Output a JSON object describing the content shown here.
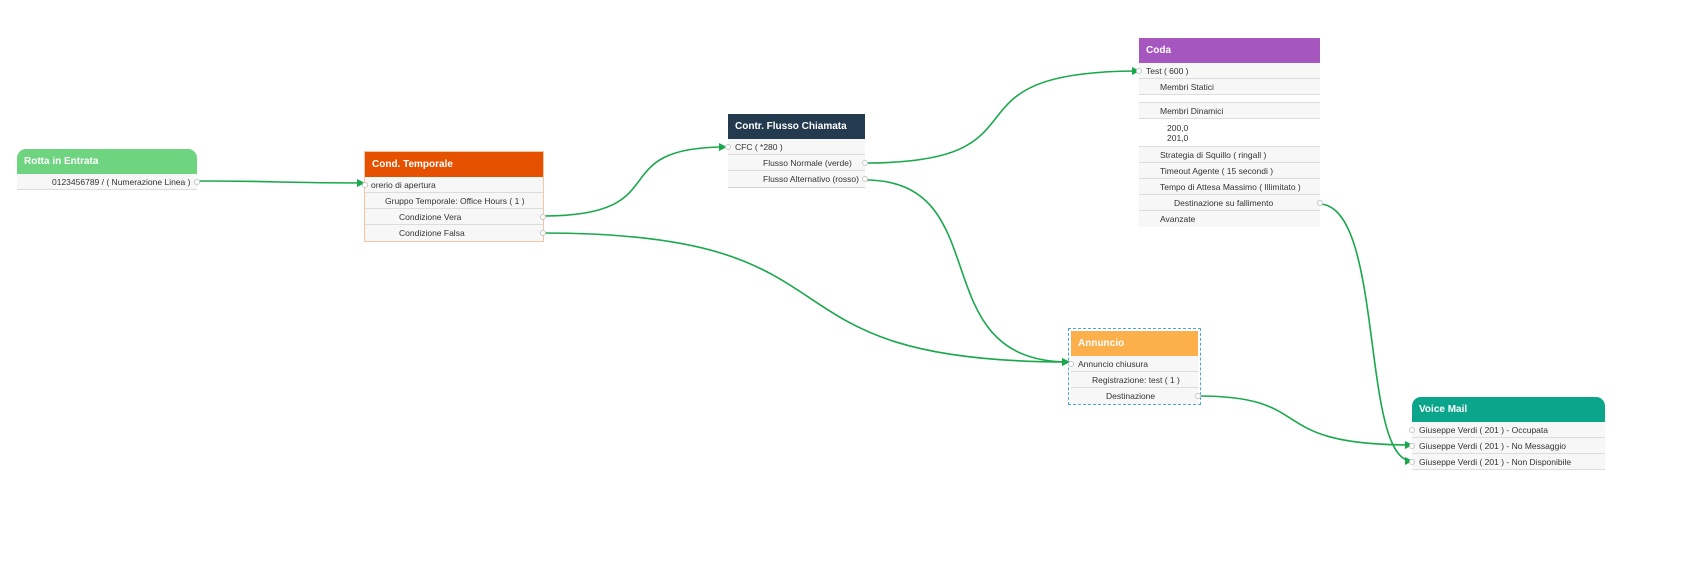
{
  "colors": {
    "wire": "#1aa84c",
    "rotta": "#6fd47f",
    "temporale": "#e65100",
    "flusso": "#243a4f",
    "coda": "#a656bf",
    "annuncio": "#fbb04c",
    "voicemail": "#0aa58a"
  },
  "rotta": {
    "title": "Rotta in Entrata",
    "rows": [
      "0123456789 / ( Numerazione Linea )"
    ]
  },
  "temporale": {
    "title": "Cond. Temporale",
    "rows": [
      "orerio di apertura",
      "Gruppo Temporale: Office Hours ( 1 )",
      "Condizione Vera",
      "Condizione Falsa"
    ]
  },
  "flusso": {
    "title": "Contr. Flusso Chiamata",
    "rows": [
      "CFC ( *280 )",
      "Flusso Normale (verde)",
      "Flusso Alternativo (rosso)"
    ]
  },
  "coda": {
    "title": "Coda",
    "rows": [
      "Test ( 600 )",
      "Membri Statici",
      "",
      "Membri Dinamici",
      "200,0",
      "201,0",
      "Strategia di Squillo ( ringall )",
      "Timeout Agente ( 15 secondi )",
      "Tempo di Attesa Massimo ( Illimitato )",
      "Destinazione su fallimento",
      "Avanzate"
    ]
  },
  "annuncio": {
    "title": "Annuncio",
    "rows": [
      "Annuncio chiusura",
      "Registrazione: test ( 1 )",
      "Destinazione"
    ]
  },
  "voicemail": {
    "title": "Voice Mail",
    "rows": [
      "Giuseppe Verdi ( 201 ) - Occupata",
      "Giuseppe Verdi ( 201 ) - No Messaggio",
      "Giuseppe Verdi ( 201 ) - Non Disponibile"
    ]
  }
}
